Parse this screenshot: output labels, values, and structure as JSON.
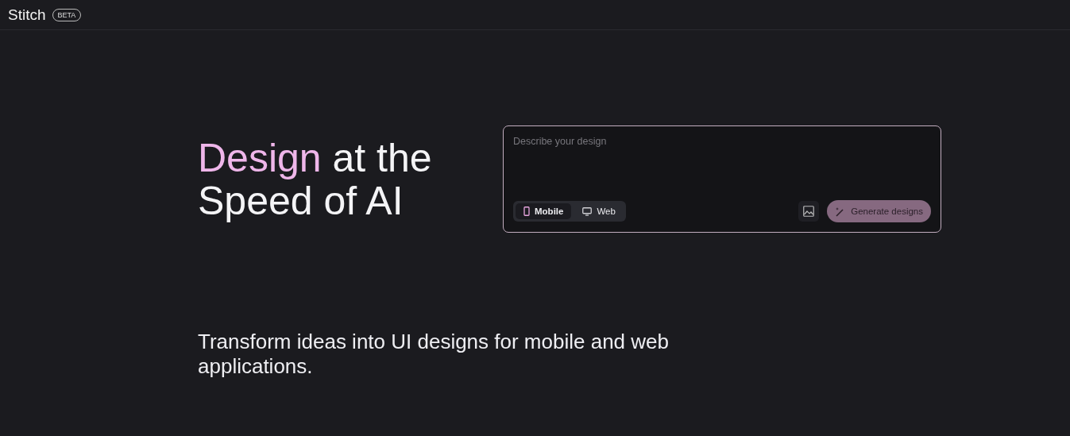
{
  "header": {
    "logo": "Stitch",
    "badge": "BETA"
  },
  "hero": {
    "accent": "Design",
    "headline": " at the Speed of AI",
    "subtitle": "Transform ideas into UI designs for mobile and web applications."
  },
  "prompt": {
    "placeholder": "Describe your design",
    "modes": [
      {
        "label": "Mobile",
        "kind": "mobile",
        "selected": true
      },
      {
        "label": "Web",
        "kind": "web",
        "selected": false
      }
    ],
    "generate_button": "Generate designs"
  }
}
